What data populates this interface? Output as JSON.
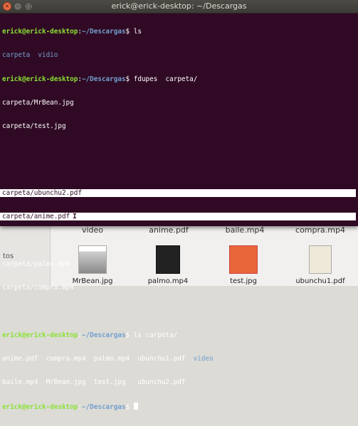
{
  "window": {
    "title": "erick@erick-desktop: ~/Descargas"
  },
  "terminal": {
    "user": "erick@erick-desktop",
    "path": "~/Descargas",
    "l1": {
      "cmd": " ls"
    },
    "l2": {
      "a": "carpeta",
      "b": "vidio"
    },
    "l3": {
      "cmd": " fdupes  carpeta/"
    },
    "l4": "carpeta/MrBean.jpg",
    "l5": "carpeta/test.jpg",
    "l7": "carpeta/ubunchu2.pdf",
    "l8": "carpeta/anime.pdf",
    "l10": "carpeta/palmo.mp4",
    "l11": "carpeta/compra.mp4",
    "l13": {
      "cmd": " ls carpeta/"
    },
    "l14": [
      "anime.pdf",
      "compra.mp4",
      "palmo.mp4",
      "ubunchu1.pdf",
      "video"
    ],
    "l15": [
      "baile.mp4",
      "MrBean.jpg",
      "test.jpg",
      "ubunchu2.pdf"
    ]
  },
  "filemanager": {
    "sidebar_label": "tos",
    "row1": [
      "video",
      "anime.pdf",
      "baile.mp4",
      "compra.mp4"
    ],
    "tiles": [
      "MrBean.jpg",
      "palmo.mp4",
      "test.jpg",
      "ubunchu1.pdf"
    ]
  }
}
